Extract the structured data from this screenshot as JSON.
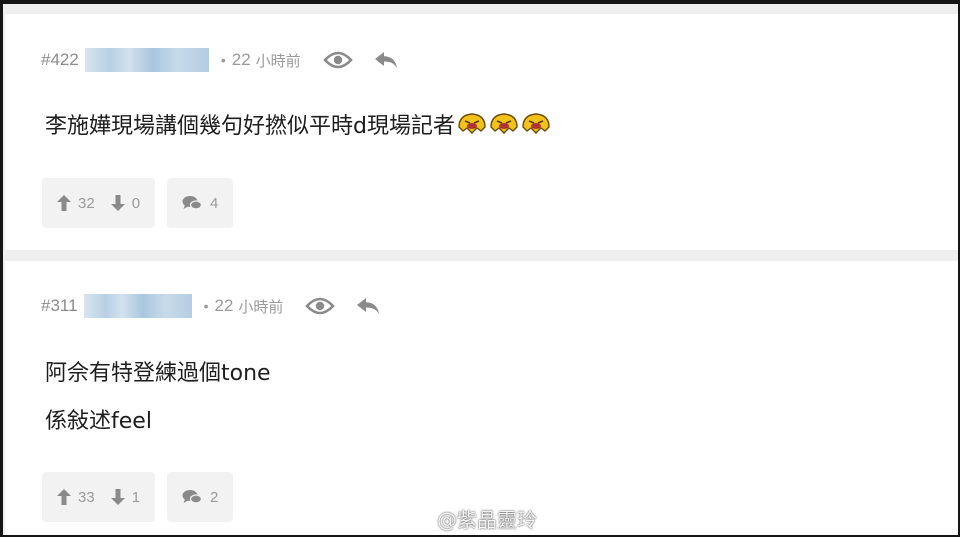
{
  "posts": [
    {
      "floor": "#422",
      "time": "22",
      "time_unit": "小時前",
      "content_lines": [
        "李施嬅現場講個幾句好撚似平時d現場記者"
      ],
      "upvotes": "32",
      "downvotes": "0",
      "comments": "4",
      "emojis": [
        "laughing-emoji",
        "laughing-emoji",
        "laughing-emoji"
      ]
    },
    {
      "floor": "#311",
      "time": "22",
      "time_unit": "小時前",
      "content_lines": [
        "阿佘有特登練過個tone",
        "係敍述feel"
      ],
      "upvotes": "33",
      "downvotes": "1",
      "comments": "2",
      "emojis": []
    }
  ],
  "watermark": "@紫晶靈玲",
  "colors": {
    "meta_text": "#9a9a9a",
    "content_text": "#1e1e1e",
    "pill_bg": "#f2f2f2",
    "icon": "#888888"
  },
  "icons": [
    "eye-icon",
    "reply-icon",
    "thumb-up-icon",
    "thumb-down-icon",
    "comment-icon",
    "weibo-icon"
  ]
}
